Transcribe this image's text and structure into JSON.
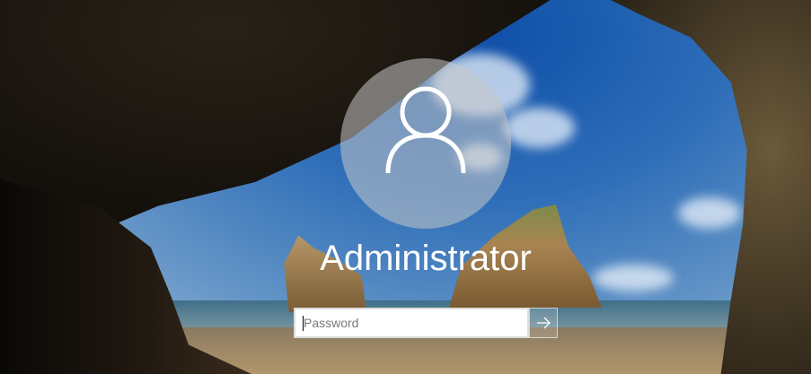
{
  "user": {
    "name": "Administrator",
    "avatar_icon": "user-icon"
  },
  "password": {
    "placeholder": "Password",
    "value": ""
  },
  "submit": {
    "icon": "arrow-right-icon"
  }
}
